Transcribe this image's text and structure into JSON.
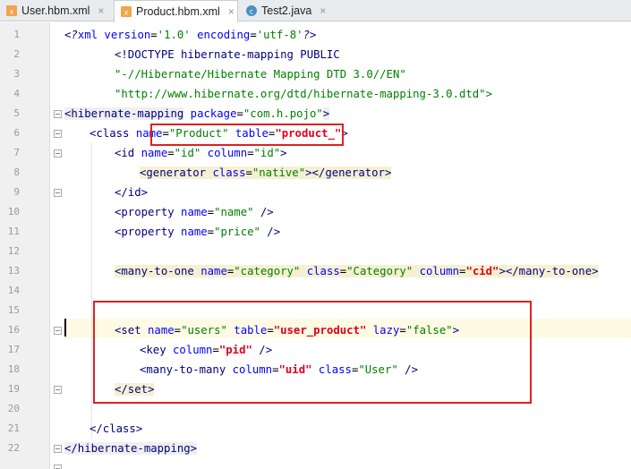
{
  "tabs": [
    {
      "label": "User.hbm.xml",
      "icon": "xml-file-icon",
      "active": false
    },
    {
      "label": "Product.hbm.xml",
      "icon": "xml-file-icon",
      "active": true
    },
    {
      "label": "Test2.java",
      "icon": "java-class-icon",
      "active": false
    }
  ],
  "close_glyph": "×",
  "line_numbers": [
    "1",
    "2",
    "3",
    "4",
    "5",
    "6",
    "7",
    "8",
    "9",
    "10",
    "11",
    "12",
    "13",
    "14",
    "15",
    "16",
    "17",
    "18",
    "19",
    "20",
    "21",
    "22"
  ],
  "current_line": "15",
  "code": {
    "l1": {
      "a": "<?",
      "b": "xml",
      "c": " version",
      "d": "=",
      "e": "'1.0'",
      "f": " encoding",
      "g": "=",
      "h": "'utf-8'",
      "i": "?>"
    },
    "l2": "<!DOCTYPE hibernate-mapping PUBLIC",
    "l3": "\"-//Hibernate/Hibernate Mapping DTD 3.0//EN\"",
    "l4": "\"http://www.hibernate.org/dtd/hibernate-mapping-3.0.dtd\">",
    "l5": {
      "open": "<hibernate-mapping",
      "attr": " package",
      "eq": "=",
      "val": "\"com.h.pojo\"",
      "close": ">"
    },
    "l6": {
      "open": "<class",
      "a1": " name",
      "v1": "\"Product\"",
      "a2": " table",
      "v2": "\"product_\"",
      "close": ">"
    },
    "l7": {
      "open": "<id",
      "a1": " name",
      "v1": "\"id\"",
      "a2": " column",
      "v2": "\"id\"",
      "close": ">"
    },
    "l8": {
      "open": "<generator",
      "a1": " class",
      "v1": "\"native\"",
      "mid": "></generator>",
      "close": ""
    },
    "l9": "</id>",
    "l10": {
      "open": "<property",
      "a1": " name",
      "v1": "\"name\"",
      "close": " />"
    },
    "l11": {
      "open": "<property",
      "a1": " name",
      "v1": "\"price\"",
      "close": " />"
    },
    "l13": {
      "open": "<many-to-one",
      "a1": " name",
      "v1": "\"category\"",
      "a2": " class",
      "v2": "\"Category\"",
      "a3": " column",
      "v3": "\"cid\"",
      "close": "></many-to-one>"
    },
    "l16": {
      "open": "<set",
      "a1": " name",
      "v1": "\"users\"",
      "a2": " table",
      "v2": "\"user_product\"",
      "a3": " lazy",
      "v3": "\"false\"",
      "close": ">"
    },
    "l17": {
      "open": "<key",
      "a1": " column",
      "v1": "\"pid\"",
      "close": " />"
    },
    "l18": {
      "open": "<many-to-many",
      "a1": " column",
      "v1": "\"uid\"",
      "a2": " class",
      "v2": "\"User\"",
      "close": " />"
    },
    "l19": "</set>",
    "l21": "</class>",
    "l22": "</hibernate-mapping>",
    "eq": "="
  },
  "colors": {
    "tag": "#000080",
    "attribute": "#0000ff",
    "value": "#008000",
    "highlight_value": "#e0001b",
    "annotation_box": "#e02020",
    "current_line_bg": "#fffae3"
  }
}
